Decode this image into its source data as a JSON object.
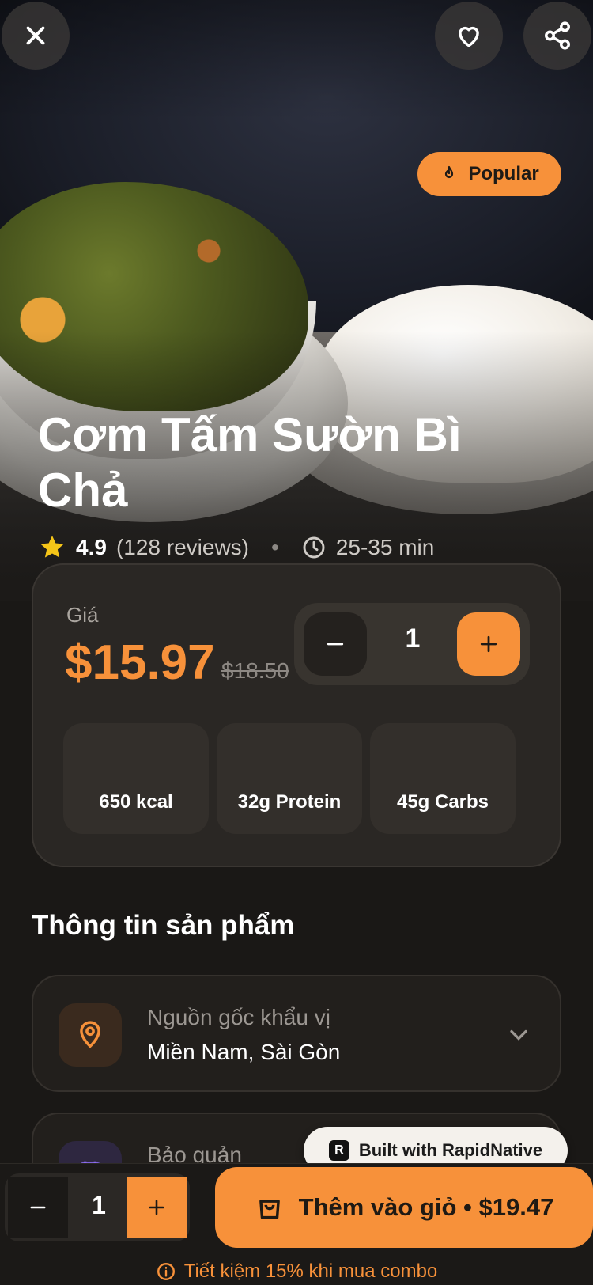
{
  "hero": {
    "badge": "Popular",
    "title": "Cơm Tấm Sườn Bì Chả",
    "rating": "4.9",
    "reviews": "(128 reviews)",
    "time": "25-35 min"
  },
  "price_card": {
    "label": "Giá",
    "price": "$15.97",
    "old_price": "$18.50",
    "quantity": "1",
    "nutrition": [
      "650 kcal",
      "32g Protein",
      "45g Carbs"
    ]
  },
  "product_info": {
    "title": "Thông tin sản phẩm",
    "items": [
      {
        "label": "Nguồn gốc khẩu vị",
        "value": "Miền Nam, Sài Gòn",
        "icon": "location-pin-icon"
      },
      {
        "label": "Bảo quản",
        "value": "",
        "icon": "calendar-icon"
      }
    ]
  },
  "badge": {
    "logo": "R",
    "text": "Built with RapidNative"
  },
  "bottom": {
    "quantity": "1",
    "add_label": "Thêm vào giỏ • $19.47",
    "savings": "Tiết kiệm 15% khi mua combo"
  },
  "colors": {
    "accent": "#f7913a",
    "background": "#1a1816",
    "card": "#2a2724"
  }
}
